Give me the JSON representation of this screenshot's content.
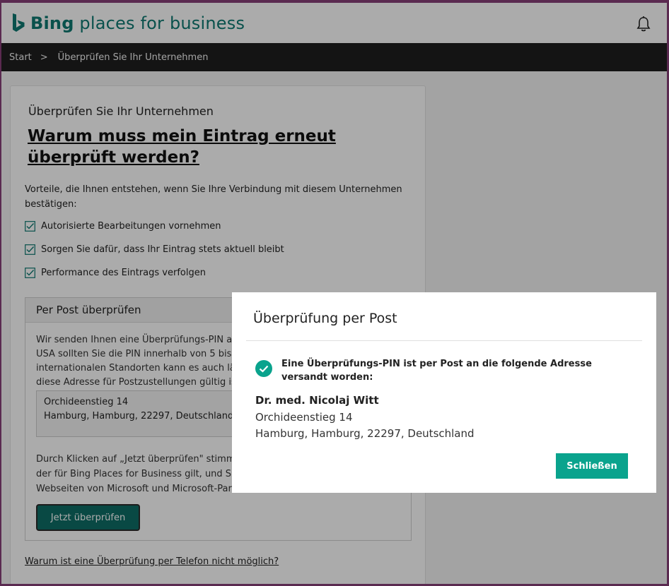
{
  "header": {
    "brand_bold": "Bing",
    "brand_rest": " places for business",
    "bell_icon": "bell-icon"
  },
  "breadcrumb": {
    "home": "Start",
    "separator": ">",
    "current": "Überprüfen Sie Ihr Unternehmen"
  },
  "card": {
    "subtitle": "Überprüfen Sie Ihr Unternehmen",
    "heading": "Warum muss mein Eintrag erneut überprüft werden?",
    "intro": "Vorteile, die Ihnen entstehen, wenn Sie Ihre Verbindung mit diesem Unternehmen bestätigen:",
    "benefits": [
      "Autorisierte Bearbeitungen vornehmen",
      "Sorgen Sie dafür, dass Ihr Eintrag stets aktuell bleibt",
      "Performance des Eintrags verfolgen"
    ],
    "benefit_icon": "checkbox-checked-icon",
    "panel": {
      "title": "Per Post überprüfen",
      "text_lines": [
        "Wir senden Ihnen eine Überprüfungs-PIN an",
        "USA sollten Sie die PIN innerhalb von 5 bis 6",
        "internationalen Standorten kann es auch läng",
        "diese Adresse für Postzustellungen gültig ist."
      ],
      "address_street": "Orchideenstieg 14",
      "address_city": "Hamburg, Hamburg, 22297, Deutschland",
      "legal_lines": [
        "Durch Klicken auf „Jetzt überprüfen\" stimmen",
        "der für Bing Places for Business gilt, und Sie e",
        "Webseiten von Microsoft und Microsoft-Partn"
      ],
      "verify_button": "Jetzt überprüfen"
    },
    "phone_link": "Warum ist eine Überprüfung per Telefon nicht möglich?"
  },
  "dialog": {
    "title": "Überprüfung per Post",
    "success_icon": "check-circle-icon",
    "message": "Eine Überprüfungs-PIN ist per Post an die folgende Adresse versandt worden:",
    "name": "Dr. med. Nicolaj Witt",
    "street": "Orchideenstieg 14",
    "city": "Hamburg, Hamburg, 22297, Deutschland",
    "close_button": "Schließen"
  },
  "colors": {
    "brand": "#0e7a72",
    "primary_button": "#0aa38d",
    "breadcrumb_bar": "#1f1f1f"
  }
}
